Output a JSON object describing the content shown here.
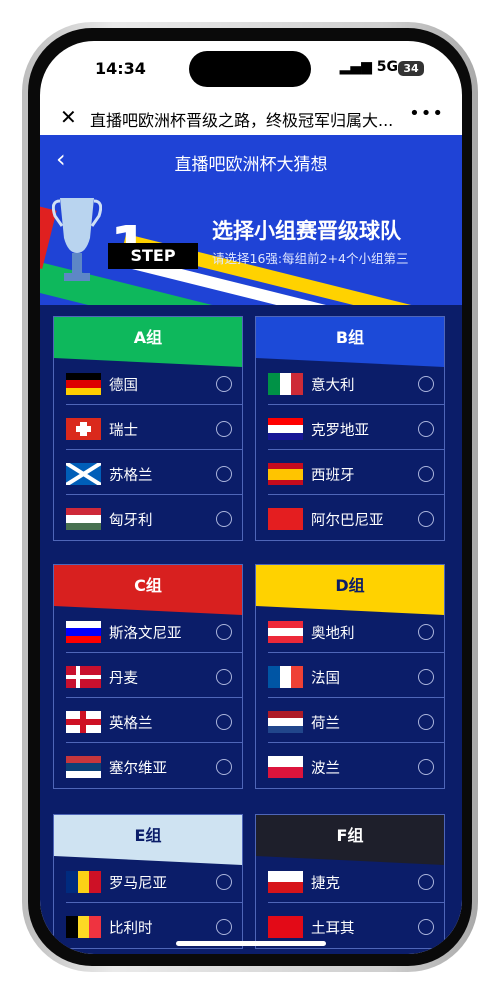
{
  "status": {
    "time": "14:34",
    "network": "5G",
    "battery": "34"
  },
  "browser": {
    "title": "直播吧欧洲杯晋级之路，终极冠军归属大...",
    "more": "•••"
  },
  "page": {
    "title": "直播吧欧洲杯大猜想"
  },
  "banner": {
    "step_number": "1",
    "step_label": "STEP",
    "heading": "选择小组赛晋级球队",
    "subheading": "请选择16强:每组前2+4个小组第三"
  },
  "groups": [
    {
      "name": "A组",
      "color": "#0eb85c",
      "text": "#fff",
      "teams": [
        {
          "name": "德国",
          "flag": [
            "#000",
            "#dd0000",
            "#ffce00"
          ],
          "dir": "h"
        },
        {
          "name": "瑞士",
          "flag": [
            "#da291c"
          ],
          "dir": "cross"
        },
        {
          "name": "苏格兰",
          "flag": [
            "#005eb8"
          ],
          "dir": "saltire"
        },
        {
          "name": "匈牙利",
          "flag": [
            "#ce2939",
            "#fff",
            "#477050"
          ],
          "dir": "h"
        }
      ]
    },
    {
      "name": "B组",
      "color": "#1c4ad8",
      "text": "#fff",
      "teams": [
        {
          "name": "意大利",
          "flag": [
            "#009246",
            "#fff",
            "#ce2b37"
          ],
          "dir": "v"
        },
        {
          "name": "克罗地亚",
          "flag": [
            "#ff0000",
            "#fff",
            "#171796"
          ],
          "dir": "h"
        },
        {
          "name": "西班牙",
          "flag": [
            "#c60b1e",
            "#ffc400",
            "#ffc400",
            "#c60b1e"
          ],
          "dir": "h"
        },
        {
          "name": "阿尔巴尼亚",
          "flag": [
            "#e41e20"
          ],
          "dir": "h"
        }
      ]
    },
    {
      "name": "C组",
      "color": "#d8201f",
      "text": "#fff",
      "teams": [
        {
          "name": "斯洛文尼亚",
          "flag": [
            "#fff",
            "#0000ff",
            "#ff0000"
          ],
          "dir": "h"
        },
        {
          "name": "丹麦",
          "flag": [
            "#c8102e"
          ],
          "dir": "nordic"
        },
        {
          "name": "英格兰",
          "flag": [
            "#fff"
          ],
          "dir": "cross-red"
        },
        {
          "name": "塞尔维亚",
          "flag": [
            "#c6363c",
            "#0c4076",
            "#fff"
          ],
          "dir": "h"
        }
      ]
    },
    {
      "name": "D组",
      "color": "#ffd200",
      "text": "#0b1d69",
      "teams": [
        {
          "name": "奥地利",
          "flag": [
            "#ed2939",
            "#fff",
            "#ed2939"
          ],
          "dir": "h"
        },
        {
          "name": "法国",
          "flag": [
            "#0055a4",
            "#fff",
            "#ef4135"
          ],
          "dir": "v"
        },
        {
          "name": "荷兰",
          "flag": [
            "#ae1c28",
            "#fff",
            "#21468b"
          ],
          "dir": "h"
        },
        {
          "name": "波兰",
          "flag": [
            "#fff",
            "#dc143c"
          ],
          "dir": "h"
        }
      ]
    },
    {
      "name": "E组",
      "color": "#cfe3f2",
      "text": "#0b1d69",
      "teams": [
        {
          "name": "罗马尼亚",
          "flag": [
            "#002b7f",
            "#fcd116",
            "#ce1126"
          ],
          "dir": "v"
        },
        {
          "name": "比利时",
          "flag": [
            "#000",
            "#fdda24",
            "#ef3340"
          ],
          "dir": "v"
        }
      ]
    },
    {
      "name": "F组",
      "color": "#1e1f2b",
      "text": "#fff",
      "teams": [
        {
          "name": "捷克",
          "flag": [
            "#fff",
            "#d7141a"
          ],
          "dir": "h"
        },
        {
          "name": "土耳其",
          "flag": [
            "#e30a17"
          ],
          "dir": "h"
        }
      ]
    }
  ]
}
